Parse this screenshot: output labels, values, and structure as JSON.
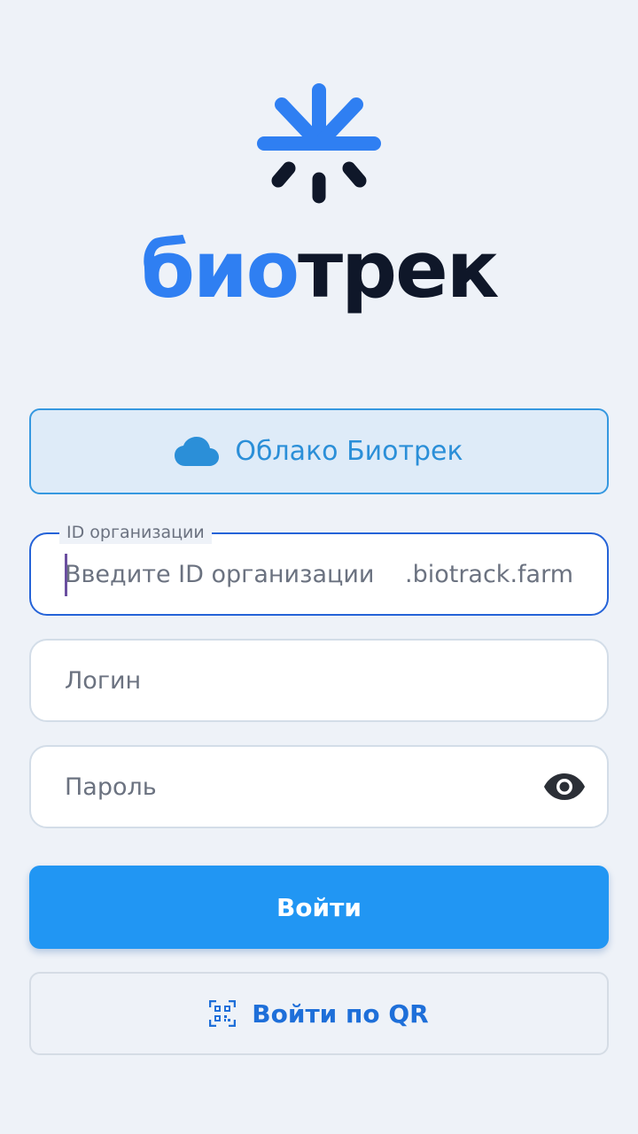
{
  "brand": {
    "wordmark_part1": "био",
    "wordmark_part2": "трек",
    "accent_color": "#2f7ff2",
    "dark_color": "#0f1729"
  },
  "cloud_button": {
    "icon": "cloud-icon",
    "label": "Облако Биотрек"
  },
  "org_id_field": {
    "legend": "ID организации",
    "placeholder": "Введите ID организации",
    "value": "",
    "suffix": ".biotrack.farm"
  },
  "login_field": {
    "placeholder": "Логин",
    "value": ""
  },
  "password_field": {
    "placeholder": "Пароль",
    "value": "",
    "toggle_icon": "eye-icon"
  },
  "submit_button": {
    "label": "Войти",
    "color": "#2196f3"
  },
  "qr_button": {
    "icon": "qr-code-icon",
    "label": "Войти по QR"
  }
}
